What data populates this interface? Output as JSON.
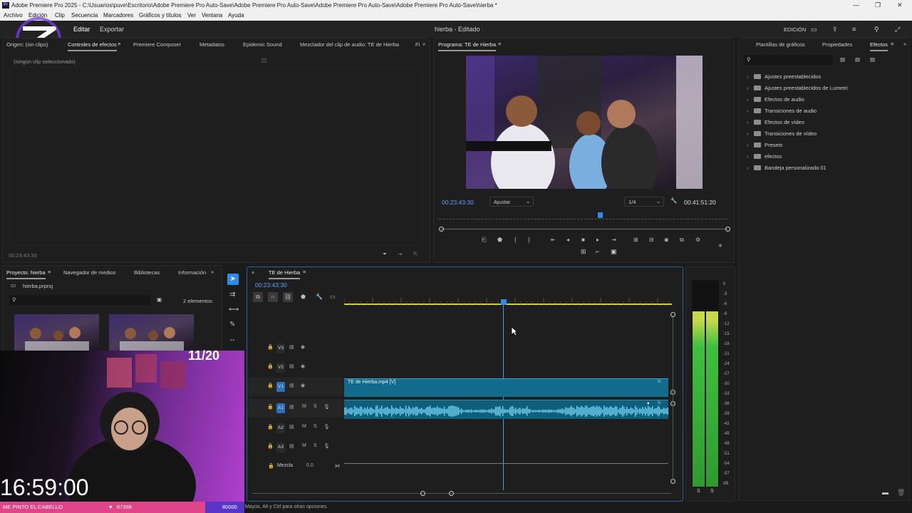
{
  "window": {
    "title": "Adobe Premiere Pro 2025 - C:\\Usuarios\\puve\\Escritorio\\Adobe Premiere Pro Auto-Save\\Adobe Premiere Pro Auto-Save\\Adobe Premiere Pro Auto-Save\\Adobe Premiere Pro Auto-Save\\hierba *"
  },
  "menu": [
    "Archivo",
    "Edición",
    "Clip",
    "Secuencia",
    "Marcadores",
    "Gráficos y títulos",
    "Ver",
    "Ventana",
    "Ayuda"
  ],
  "workspace": {
    "tab_edit": "Editar",
    "tab_export": "Exportar",
    "project_title": "hierba - Editado",
    "mode": "EDICIÓN"
  },
  "source_panel": {
    "tabs": [
      "Origen: (sin clips)",
      "Controles de efectos",
      "Premiere Composer",
      "Metadatos",
      "Epidemic Sound",
      "Mezclador del clip de audio: TE de Hierba",
      "Fi"
    ],
    "no_clip": "(ningún clip seleccionado)",
    "timecode": "00:23:43:30"
  },
  "program": {
    "title": "Programa: TE de Hierba",
    "timecode": "00:23:43:30",
    "fit": "Ajustar",
    "resolution": "1/4",
    "duration": "00:41:51:20",
    "playhead": 0.557
  },
  "effects_panel": {
    "tabs": [
      "Plantillas de gráficos",
      "Propiedades",
      "Efectos"
    ],
    "items": [
      "Ajustes preestablecidos",
      "Ajustes preestablecidos de Lumetri",
      "Efectos de audio",
      "Transiciones de audio",
      "Efectos de vídeo",
      "Transiciones de vídeo",
      "Presets",
      "efectos",
      "Bandeja personalizada 01"
    ]
  },
  "project_panel": {
    "tabs": [
      "Proyecto: hierba",
      "Navegador de medios",
      "Bibliotecas",
      "Información"
    ],
    "file": "hierba.prproj",
    "count": "2 elementos"
  },
  "timeline": {
    "tab": "TE de Hierba",
    "timecode": "00:23:43:30",
    "tracks": [
      {
        "id": "V3",
        "type": "video"
      },
      {
        "id": "V2",
        "type": "video"
      },
      {
        "id": "V1",
        "type": "video"
      },
      {
        "id": "A1",
        "type": "audio"
      },
      {
        "id": "A2",
        "type": "audio"
      },
      {
        "id": "A3",
        "type": "audio"
      }
    ],
    "mix_label": "Mezcla",
    "mix_value": "0.0",
    "clip_video": "TE de Hierba.mp4 [V]",
    "playhead": 0.49
  },
  "meters": {
    "scale": [
      "0",
      "-3",
      "-6",
      "-9",
      "-12",
      "-15",
      "-18",
      "-21",
      "-24",
      "-27",
      "-30",
      "-33",
      "-36",
      "-39",
      "-42",
      "-45",
      "-48",
      "-51",
      "-54",
      "-57",
      "dB"
    ],
    "solo": [
      "S",
      "S"
    ],
    "level": 0.85
  },
  "overlay": {
    "counter": "11/20",
    "clock": "16:59:00",
    "goal_text": "ME PINTO EL CABELLO",
    "goal_value": "67398",
    "goal_total": "80000"
  },
  "status": {
    "hint": "Mayús, Alt y Ctrl para otras opciones."
  },
  "colors": {
    "accent": "#2d8ceb",
    "clip_video": "#126b8c",
    "clip_audio": "#0f5f7b",
    "timecode": "#5aa0ff",
    "meter": "#3fbf3f"
  }
}
